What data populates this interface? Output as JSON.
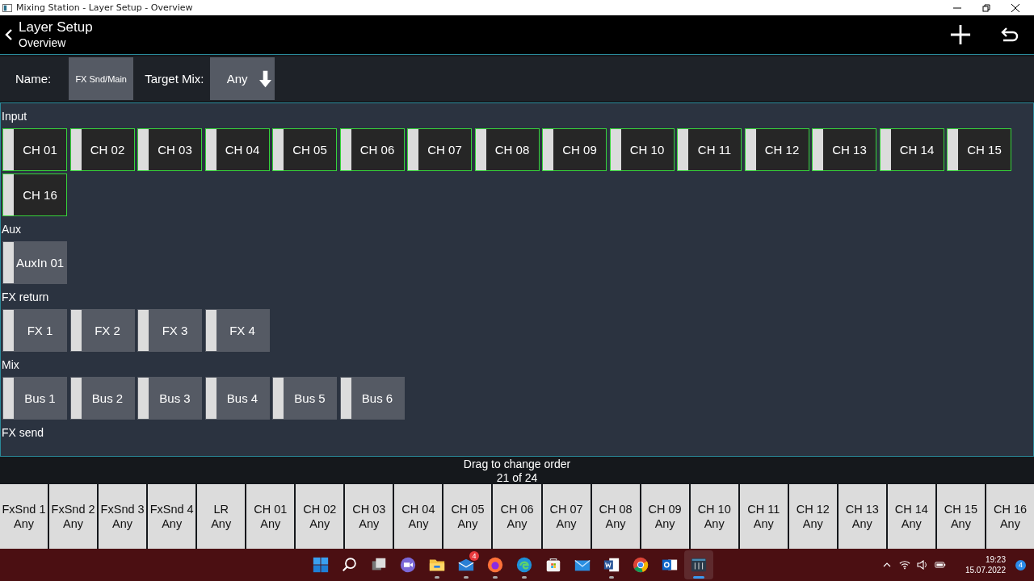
{
  "window": {
    "title": "Mixing Station - Layer Setup - Overview"
  },
  "header": {
    "title": "Layer Setup",
    "subtitle": "Overview"
  },
  "form": {
    "name_label": "Name:",
    "name_value": "FX Snd/Main",
    "target_label": "Target Mix:",
    "target_value": "Any"
  },
  "groups": [
    {
      "title": "Input",
      "items": [
        {
          "label": "CH 01",
          "selected": true
        },
        {
          "label": "CH 02",
          "selected": true
        },
        {
          "label": "CH 03",
          "selected": true
        },
        {
          "label": "CH 04",
          "selected": true
        },
        {
          "label": "CH 05",
          "selected": true
        },
        {
          "label": "CH 06",
          "selected": true
        },
        {
          "label": "CH 07",
          "selected": true
        },
        {
          "label": "CH 08",
          "selected": true
        },
        {
          "label": "CH 09",
          "selected": true
        },
        {
          "label": "CH 10",
          "selected": true
        },
        {
          "label": "CH 11",
          "selected": true
        },
        {
          "label": "CH 12",
          "selected": true
        },
        {
          "label": "CH 13",
          "selected": true
        },
        {
          "label": "CH 14",
          "selected": true
        },
        {
          "label": "CH 15",
          "selected": true
        },
        {
          "label": "CH 16",
          "selected": true
        }
      ]
    },
    {
      "title": "Aux",
      "items": [
        {
          "label": "AuxIn 01",
          "selected": false
        }
      ]
    },
    {
      "title": "FX return",
      "items": [
        {
          "label": "FX 1",
          "selected": false
        },
        {
          "label": "FX 2",
          "selected": false
        },
        {
          "label": "FX 3",
          "selected": false
        },
        {
          "label": "FX 4",
          "selected": false
        }
      ]
    },
    {
      "title": "Mix",
      "items": [
        {
          "label": "Bus 1",
          "selected": false
        },
        {
          "label": "Bus 2",
          "selected": false
        },
        {
          "label": "Bus 3",
          "selected": false
        },
        {
          "label": "Bus 4",
          "selected": false
        },
        {
          "label": "Bus 5",
          "selected": false
        },
        {
          "label": "Bus 6",
          "selected": false
        }
      ]
    },
    {
      "title": "FX send"
    }
  ],
  "order": {
    "hint": "Drag to change order",
    "count": "21 of 24",
    "items": [
      {
        "label": "FxSnd 1",
        "target": "Any"
      },
      {
        "label": "FxSnd 2",
        "target": "Any"
      },
      {
        "label": "FxSnd 3",
        "target": "Any"
      },
      {
        "label": "FxSnd 4",
        "target": "Any"
      },
      {
        "label": "LR",
        "target": "Any"
      },
      {
        "label": "CH 01",
        "target": "Any"
      },
      {
        "label": "CH 02",
        "target": "Any"
      },
      {
        "label": "CH 03",
        "target": "Any"
      },
      {
        "label": "CH 04",
        "target": "Any"
      },
      {
        "label": "CH 05",
        "target": "Any"
      },
      {
        "label": "CH 06",
        "target": "Any"
      },
      {
        "label": "CH 07",
        "target": "Any"
      },
      {
        "label": "CH 08",
        "target": "Any"
      },
      {
        "label": "CH 09",
        "target": "Any"
      },
      {
        "label": "CH 10",
        "target": "Any"
      },
      {
        "label": "CH 11",
        "target": "Any"
      },
      {
        "label": "CH 12",
        "target": "Any"
      },
      {
        "label": "CH 13",
        "target": "Any"
      },
      {
        "label": "CH 14",
        "target": "Any"
      },
      {
        "label": "CH 15",
        "target": "Any"
      },
      {
        "label": "CH 16",
        "target": "Any"
      }
    ]
  },
  "taskbar": {
    "apps": [
      {
        "kind": "start",
        "running": false,
        "selected": false
      },
      {
        "kind": "search",
        "running": false,
        "selected": false
      },
      {
        "kind": "taskview",
        "running": false,
        "selected": false
      },
      {
        "kind": "chat",
        "running": false,
        "selected": false
      },
      {
        "kind": "folder",
        "running": true,
        "selected": false
      },
      {
        "kind": "mail",
        "running": true,
        "selected": false,
        "badge": "4"
      },
      {
        "kind": "firefox",
        "running": true,
        "selected": false
      },
      {
        "kind": "edge",
        "running": true,
        "selected": false
      },
      {
        "kind": "store",
        "running": false,
        "selected": false
      },
      {
        "kind": "envelope",
        "running": false,
        "selected": false
      },
      {
        "kind": "word",
        "running": true,
        "selected": false
      },
      {
        "kind": "chrome",
        "running": false,
        "selected": false
      },
      {
        "kind": "outlook",
        "running": false,
        "selected": false
      },
      {
        "kind": "mixer",
        "running": true,
        "selected": true
      }
    ],
    "time": "19:23",
    "date": "15.07.2022",
    "notifications": "4"
  }
}
